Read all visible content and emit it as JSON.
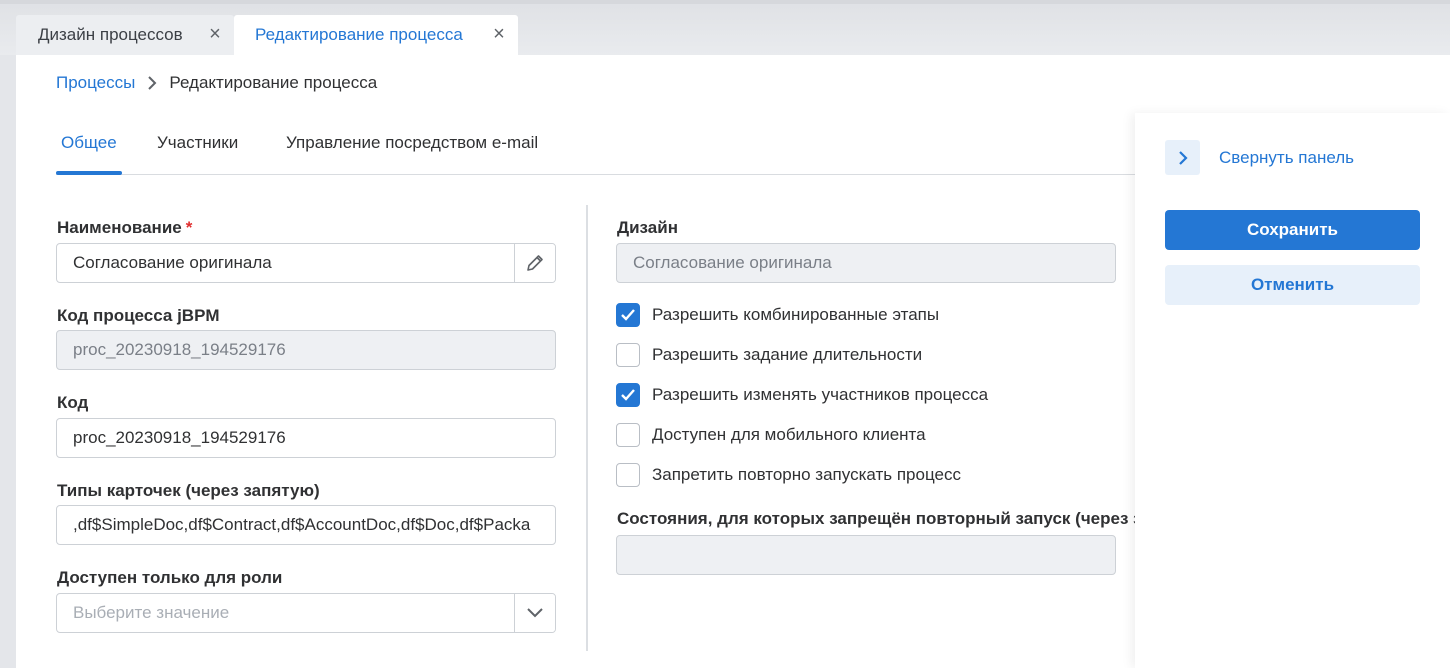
{
  "tabs": [
    {
      "label": "Дизайн процессов",
      "close": "×"
    },
    {
      "label": "Редактирование процесса",
      "close": "×"
    }
  ],
  "breadcrumb": {
    "root": "Процессы",
    "current": "Редактирование процесса"
  },
  "subtabs": [
    "Общее",
    "Участники",
    "Управление посредством e-mail"
  ],
  "form": {
    "name": {
      "label": "Наименование",
      "required_mark": "*",
      "value": "Согласование оригинала"
    },
    "jbpm_code": {
      "label": "Код процесса jBPM",
      "value": "proc_20230918_194529176"
    },
    "code": {
      "label": "Код",
      "value": "proc_20230918_194529176"
    },
    "card_types": {
      "label": "Типы карточек (через запятую)",
      "value": ",df$SimpleDoc,df$Contract,df$AccountDoc,df$Doc,df$Packa"
    },
    "role": {
      "label": "Доступен только для роли",
      "placeholder": "Выберите значение"
    },
    "design": {
      "label": "Дизайн",
      "value": "Согласование оригинала"
    },
    "checkboxes": [
      {
        "label": "Разрешить комбинированные этапы",
        "checked": true
      },
      {
        "label": "Разрешить задание длительности",
        "checked": false
      },
      {
        "label": "Разрешить изменять участников процесса",
        "checked": true
      },
      {
        "label": "Доступен для мобильного клиента",
        "checked": false
      },
      {
        "label": "Запретить повторно запускать процесс",
        "checked": false
      }
    ],
    "states": {
      "label": "Состояния, для которых запрещён повторный запуск (через з",
      "value": ""
    }
  },
  "sidepanel": {
    "collapse_label": "Свернуть панель",
    "save_label": "Сохранить",
    "cancel_label": "Отменить"
  },
  "colors": {
    "accent": "#2477d4",
    "required": "#e02d2d"
  }
}
